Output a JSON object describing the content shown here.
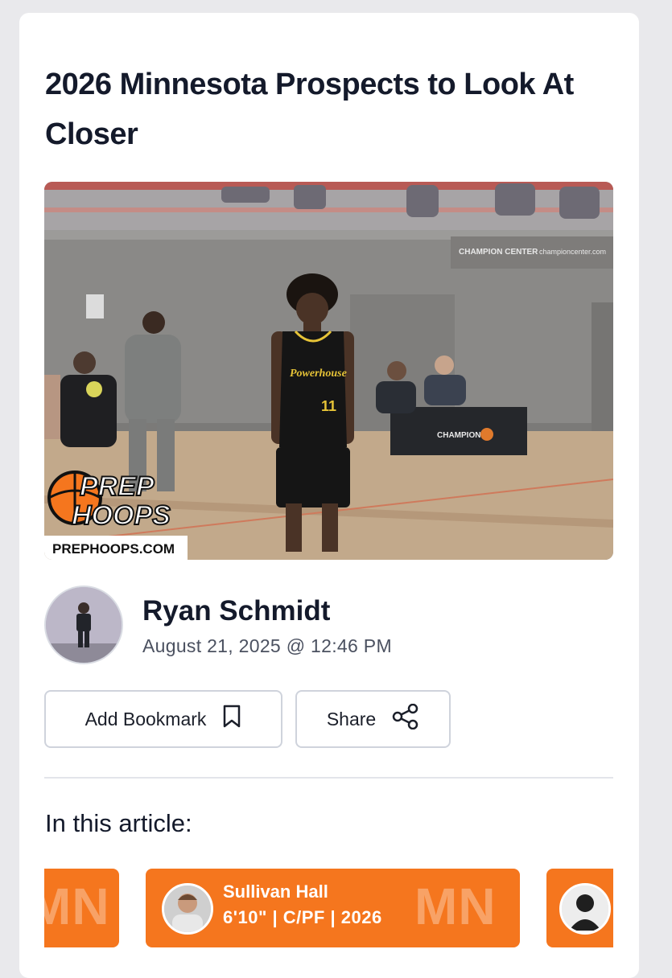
{
  "article": {
    "title": "2026 Minnesota Prospects to Look At Closer",
    "image": {
      "watermark_line1": "PREP",
      "watermark_line2": "HOOPS",
      "watermark_site": "PREPHOOPS.COM",
      "jersey_text": "Powerhouse",
      "jersey_number": "11",
      "banner_text": "CHAMPION CENTER",
      "banner_site": "championcenter.com"
    }
  },
  "author": {
    "name": "Ryan Schmidt",
    "date": "August 21, 2025 @ 12:46 PM"
  },
  "actions": {
    "bookmark_label": "Add Bookmark",
    "bookmark_icon": "bookmark-icon",
    "share_label": "Share",
    "share_icon": "share-icon"
  },
  "in_article": {
    "heading": "In this article:",
    "players": [
      {
        "state": "MN",
        "name": "",
        "info": ""
      },
      {
        "state": "MN",
        "name": "Sullivan Hall",
        "info": "6'10\" | C/PF | 2026"
      },
      {
        "state": "",
        "name": "",
        "info": ""
      }
    ]
  },
  "colors": {
    "accent": "#f5761e",
    "text": "#141a2b",
    "muted": "#4b5160",
    "border": "#cfd3dc"
  }
}
